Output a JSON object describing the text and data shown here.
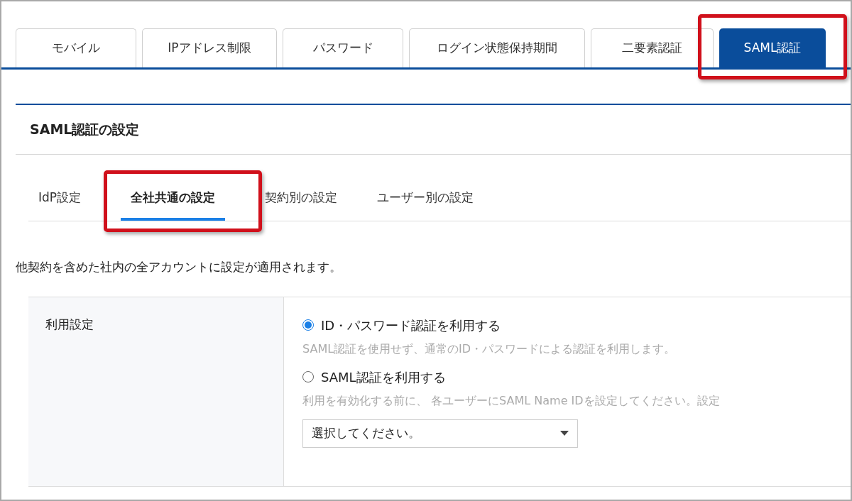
{
  "tabs": [
    {
      "label": "モバイル",
      "selected": false,
      "highlighted": false
    },
    {
      "label": "IPアドレス制限",
      "selected": false,
      "highlighted": false
    },
    {
      "label": "パスワード",
      "selected": false,
      "highlighted": false
    },
    {
      "label": "ログイン状態保持期間",
      "selected": false,
      "highlighted": false
    },
    {
      "label": "二要素認証",
      "selected": false,
      "highlighted": false
    },
    {
      "label": "SAML認証",
      "selected": true,
      "highlighted": true
    }
  ],
  "panel": {
    "title": "SAML認証の設定",
    "subtabs": [
      {
        "label": "IdP設定",
        "selected": false,
        "highlighted": false
      },
      {
        "label": "全社共通の設定",
        "selected": true,
        "highlighted": true
      },
      {
        "label": "契約別の設定",
        "selected": false,
        "highlighted": false
      },
      {
        "label": "ユーザー別の設定",
        "selected": false,
        "highlighted": false
      }
    ],
    "description": "他契約を含めた社内の全アカウントに設定が適用されます。",
    "setting": {
      "label": "利用設定",
      "options": [
        {
          "label": "ID・パスワード認証を利用する",
          "selected": true,
          "help": "SAML認証を使用せず、通常のID・パスワードによる認証を利用します。"
        },
        {
          "label": "SAML認証を利用する",
          "selected": false,
          "help": "利用を有効化する前に、 各ユーザーにSAML Name IDを設定してください。設定"
        }
      ],
      "select": {
        "value": "選択してください。"
      }
    }
  }
}
